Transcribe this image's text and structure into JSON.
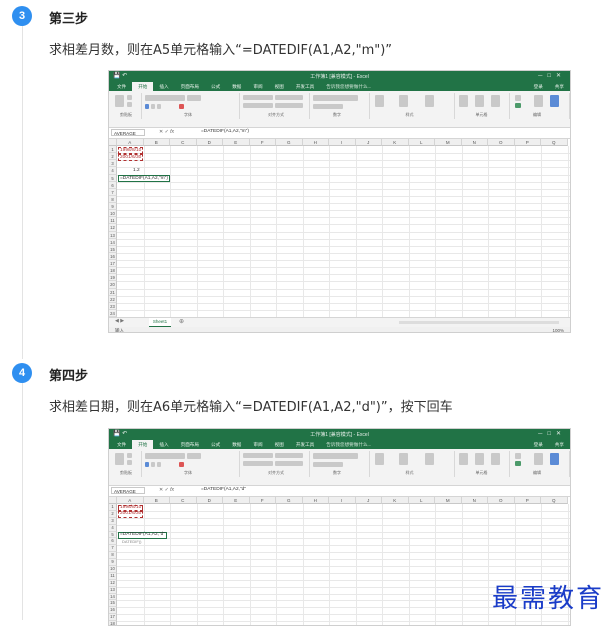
{
  "steps": [
    {
      "number": "3",
      "title": "第三步",
      "description": "求相差月数，则在A5单元格输入“=DATEDIF(A1,A2,\"m\")”",
      "screenshot": {
        "window_title": "工作簿1 [兼容模式] - Excel",
        "name_box": "AVERAGE",
        "formula": "=DATEDIF(A1,A2,\"m\")",
        "cells": [
          {
            "ref": "A1",
            "value": "1998/8/10"
          },
          {
            "ref": "A2",
            "value": "2001/6/30"
          },
          {
            "ref": "A4",
            "value": "1.2"
          },
          {
            "ref": "A5",
            "value": "=DATEDIF(A1,A2,\"m\")"
          }
        ],
        "sheet_tab": "Sheet1",
        "status": "输入",
        "zoom": "100%"
      }
    },
    {
      "number": "4",
      "title": "第四步",
      "description": "求相差日期，则在A6单元格输入“=DATEDIF(A1,A2,\"d\")”，按下回车",
      "screenshot": {
        "window_title": "工作簿1 [兼容模式] - Excel",
        "name_box": "AVERAGE",
        "formula": "=DATEDIF(A1,A2,\"d\"",
        "cells": [
          {
            "ref": "A1",
            "value": "1998/8/10"
          },
          {
            "ref": "A2",
            "value": "2001/6/30"
          },
          {
            "ref": "A5",
            "value": "=DATEDIF(A1,A2,\"d\""
          },
          {
            "ref": "A6",
            "value": "DATEDIF()"
          }
        ]
      }
    }
  ],
  "excel": {
    "tabs": [
      "文件",
      "开始",
      "插入",
      "页面布局",
      "公式",
      "数据",
      "审阅",
      "视图",
      "开发工具"
    ],
    "active_tab": "开始",
    "tell_me": "告诉我您想要做什么...",
    "sign_in": "登录",
    "share": "共享",
    "ribbon_groups": [
      "剪贴板",
      "字体",
      "对齐方式",
      "数字",
      "样式",
      "单元格",
      "编辑"
    ],
    "columns": [
      "A",
      "B",
      "C",
      "D",
      "E",
      "F",
      "G",
      "H",
      "I",
      "J",
      "K",
      "L",
      "M",
      "N",
      "O",
      "P",
      "Q"
    ]
  },
  "watermark": "最需教育",
  "colors": {
    "step_badge": "#2f8ff0",
    "excel_green": "#217346",
    "watermark": "#1a3cc8"
  }
}
